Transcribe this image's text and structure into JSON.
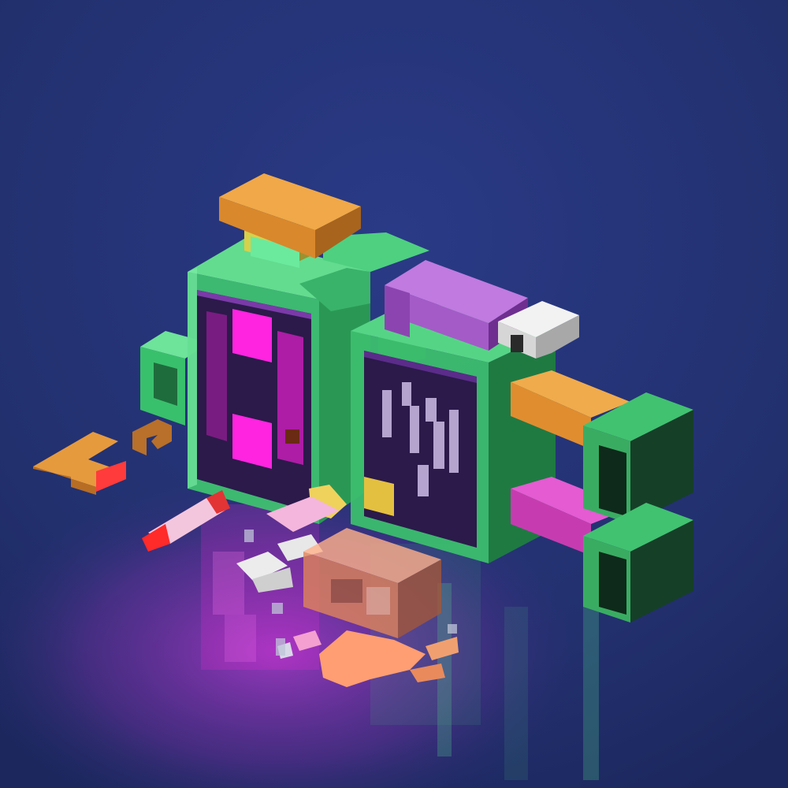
{
  "scene": {
    "background_color": "#243070",
    "floor_glow_color": "#b13ad0",
    "palette": {
      "green_light": "#49d27d",
      "green_mid": "#2ea55a",
      "green_dark": "#134d2a",
      "magenta": "#ff24e0",
      "screen_dark": "#2b1a4a",
      "orange": "#e29a3a",
      "orange_dark": "#b86d24",
      "purple": "#a45bc8",
      "purple_dark": "#6e2f90",
      "white": "#e8e8e8",
      "grey": "#9b9b9b",
      "red": "#ff2a2a",
      "pink": "#f5a6d6",
      "yellow": "#f1d24a",
      "salmon": "#ff9c6a"
    }
  }
}
